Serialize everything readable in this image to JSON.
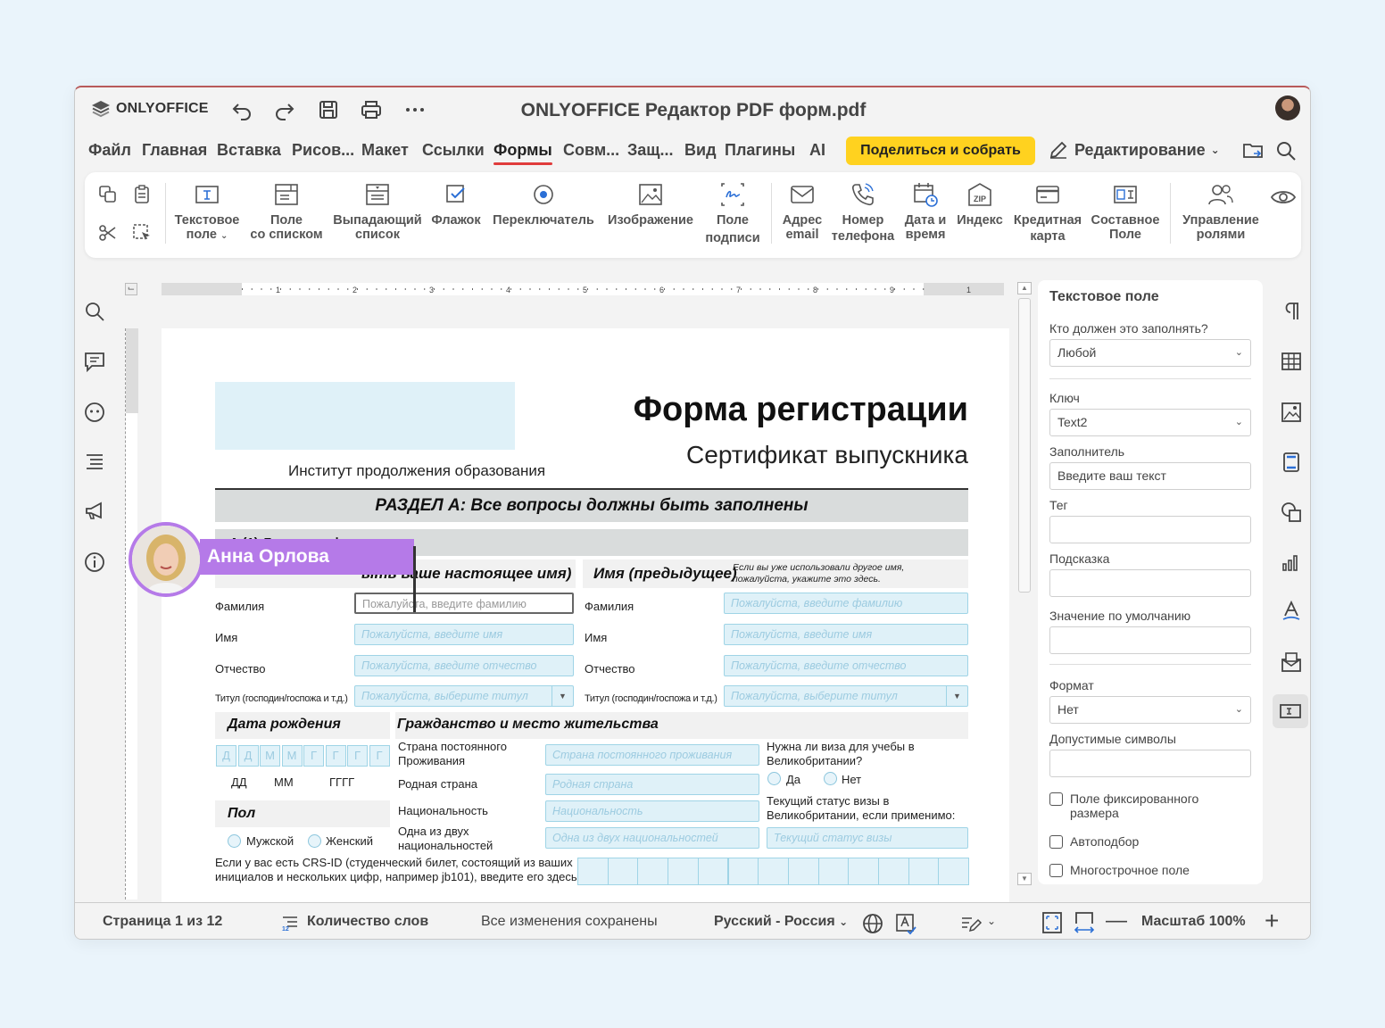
{
  "app": {
    "brand": "ONLYOFFICE",
    "title": "ONLYOFFICE Редактор PDF форм.pdf"
  },
  "menu": {
    "items": [
      "Файл",
      "Главная",
      "Вставка",
      "Рисов...",
      "Макет",
      "Ссылки",
      "Формы",
      "Совм...",
      "Защ...",
      "Вид",
      "Плагины",
      "AI"
    ],
    "active": "Формы",
    "share_label": "Поделиться и собрать",
    "mode_label": "Редактирование"
  },
  "ribbon": {
    "text_field": [
      "Текстовое",
      "поле"
    ],
    "combo_box": [
      "Поле",
      "со списком"
    ],
    "dropdown": [
      "Выпадающий",
      "список"
    ],
    "checkbox": "Флажок",
    "radio": "Переключатель",
    "image": "Изображение",
    "signature": [
      "Поле",
      "подписи"
    ],
    "email": [
      "Адрес",
      "email"
    ],
    "phone": [
      "Номер",
      "телефона"
    ],
    "datetime": [
      "Дата и",
      "время"
    ],
    "zip": "Индекс",
    "credit_card": [
      "Кредитная",
      "карта"
    ],
    "complex": [
      "Составное",
      "Поле"
    ],
    "roles": [
      "Управление",
      "ролями"
    ]
  },
  "ruler": {
    "numbers": [
      "1",
      "2",
      "3",
      "4",
      "5",
      "6",
      "7",
      "8",
      "9",
      "1"
    ]
  },
  "form": {
    "title": "Форма регистрации",
    "subtitle": "Сертификат выпускника",
    "institute": "Институт продолжения образования",
    "section_a": "РАЗДЕЛ A: Все вопросы должны быть заполнены",
    "a1": "A (1) Личная информация",
    "current_name": "Ваше имя (напишите ваше настоящее имя)",
    "current_name_visible": "ыть ваше настоящее имя)",
    "prev_name": "Имя (предыдущее)",
    "prev_name_note": "Если вы уже использовали другое имя, пожалуйста, укажите это здесь.",
    "labels": {
      "surname": "Фамилия",
      "name": "Имя",
      "patronymic": "Отчество",
      "title": "Титул (господин/госпожа и т.д.)"
    },
    "placeholders": {
      "surname": "Пожалуйста, введите фамилию",
      "name": "Пожалуйста, введите имя",
      "patronymic": "Пожалуйста, введите отчество",
      "title": "Пожалуйста, выберите титул",
      "residence": "Страна постоянного проживания",
      "native": "Родная страна",
      "nationality": "Национальность",
      "dual": "Одна из двух национальностей",
      "visa_status": "Текущий статус визы"
    },
    "dob": "Дата рождения",
    "dob_cells": [
      "Д",
      "Д",
      "М",
      "М",
      "Г",
      "Г",
      "Г",
      "Г"
    ],
    "dob_legend": [
      "ДД",
      "ММ",
      "ГГГГ"
    ],
    "citizenship": "Гражданство и место жительства",
    "residence_label": [
      "Страна постоянного",
      "Проживания"
    ],
    "native_label": "Родная страна",
    "nationality_label": "Национальность",
    "dual_label": [
      "Одна из двух",
      "национальностей"
    ],
    "visa_question": [
      "Нужна ли виза для учебы в",
      "Великобритании?"
    ],
    "yes": "Да",
    "no": "Нет",
    "visa_status_label": [
      "Текущий статус визы в",
      "Великобритании, если применимо:"
    ],
    "gender": "Пол",
    "male": "Мужской",
    "female": "Женский",
    "crs": [
      "Если у вас есть CRS-ID (студенческий билет, состоящий из ваших",
      "инициалов и нескольких цифр, например jb101), введите его здесь:"
    ]
  },
  "collaborator": {
    "name": "Анна Орлова",
    "color": "#b57ae8"
  },
  "panel": {
    "title": "Текстовое поле",
    "who_label": "Кто должен это заполнять?",
    "who_value": "Любой",
    "key_label": "Ключ",
    "key_value": "Text2",
    "placeholder_label": "Заполнитель",
    "placeholder_value": "Введите ваш текст",
    "tag_label": "Тег",
    "tip_label": "Подсказка",
    "default_label": "Значение по умолчанию",
    "format_label": "Формат",
    "format_value": "Нет",
    "allowed_label": "Допустимые символы",
    "fixed_size": [
      "Поле фиксированного",
      "размера"
    ],
    "autofit": "Автоподбор",
    "multiline": "Многострочное поле"
  },
  "status": {
    "page": "Страница 1 из 12",
    "word_count": "Количество слов",
    "saved": "Все изменения сохранены",
    "language": "Русский - Россия",
    "zoom": "Масштаб 100%"
  },
  "colors": {
    "accent": "#e03c3c",
    "share": "#ffd21f",
    "field_bg": "#dff1f8",
    "field_border": "#9fd4e6"
  }
}
